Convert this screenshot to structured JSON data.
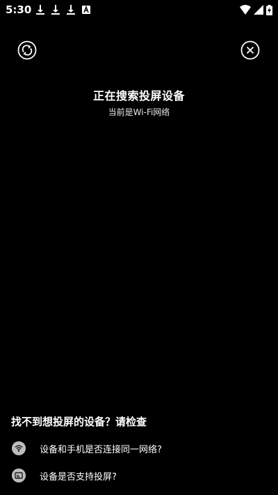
{
  "status_bar": {
    "time": "5:30",
    "left_icons": [
      "download-icon",
      "download-icon",
      "download-icon",
      "a-badge-icon"
    ],
    "right_icons": [
      "wifi-icon",
      "signal-icon",
      "battery-charging-icon"
    ]
  },
  "header": {
    "refresh_icon": "refresh-icon",
    "close_icon": "close-icon"
  },
  "search": {
    "title": "正在搜索投屏设备",
    "subtitle": "当前是Wi-Fi网络"
  },
  "help": {
    "title": "找不到想投屏的设备？请检查",
    "items": [
      {
        "icon": "wifi-icon",
        "text": "设备和手机是否连接同一网络?"
      },
      {
        "icon": "cast-icon",
        "text": "设备是否支持投屏?"
      }
    ]
  },
  "colors": {
    "background": "#000000",
    "text": "#ffffff",
    "icon_circle": "#bdbdbd"
  }
}
